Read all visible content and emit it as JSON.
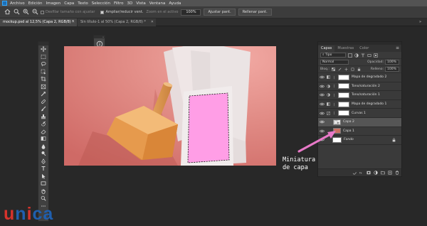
{
  "menubar": {
    "items": [
      "Archivo",
      "Edición",
      "Imagen",
      "Capa",
      "Texto",
      "Selección",
      "Filtro",
      "3D",
      "Vista",
      "Ventana",
      "Ayuda"
    ]
  },
  "options": {
    "zoom_all_label": "Desfilar tamaño con ajustar",
    "resize_windows_label": "Ampliar/reducir vent.",
    "zoom_all_windows_label": "Zoom en el activo",
    "zoom_value": "100%",
    "fit_screen_label": "Ajustar pant.",
    "fill_screen_label": "Rellenar pant."
  },
  "tabs": [
    {
      "label": "mockup.psd al 12,5% (Capa 2, RGB/8) *"
    },
    {
      "label": "Sin título-1 al 50% (Capa 2, RGB/8) *"
    }
  ],
  "layers_panel": {
    "tabs": [
      "Capas",
      "Muestras",
      "Color"
    ],
    "filter_value": "Tipo",
    "blend_mode": "Normal",
    "opacity_label": "Opacidad:",
    "opacity_value": "100%",
    "lock_label": "Bloq.:",
    "fill_label": "Relleno:",
    "fill_value": "100%",
    "layers": [
      {
        "name": "Mapa de degradado 2",
        "kind": "adjustment",
        "selected": false
      },
      {
        "name": "Tono/saturación 2",
        "kind": "adjustment",
        "selected": false
      },
      {
        "name": "Tono/saturación 1",
        "kind": "adjustment",
        "selected": false
      },
      {
        "name": "Mapa de degradado 1",
        "kind": "adjustment",
        "selected": false
      },
      {
        "name": "Curvas 1",
        "kind": "adjustment",
        "selected": false
      },
      {
        "name": "Capa 2",
        "kind": "smart",
        "selected": true
      },
      {
        "name": "Capa 1",
        "kind": "image",
        "selected": false
      },
      {
        "name": "Fondo",
        "kind": "background",
        "selected": false
      }
    ]
  },
  "annotation": {
    "line1": "Miniatura",
    "line2": "de capa"
  },
  "logo": {
    "letters": [
      "u",
      "n",
      "i",
      "c",
      "a"
    ],
    "colors": [
      "#d6332c",
      "#1f5fae",
      "#d6332c",
      "#1f5fae",
      "#1f5fae"
    ]
  },
  "colors": {
    "accent_pink": "#e879c8",
    "canvas_bg": "#d97871",
    "selected_layer_bg": "#555555"
  }
}
